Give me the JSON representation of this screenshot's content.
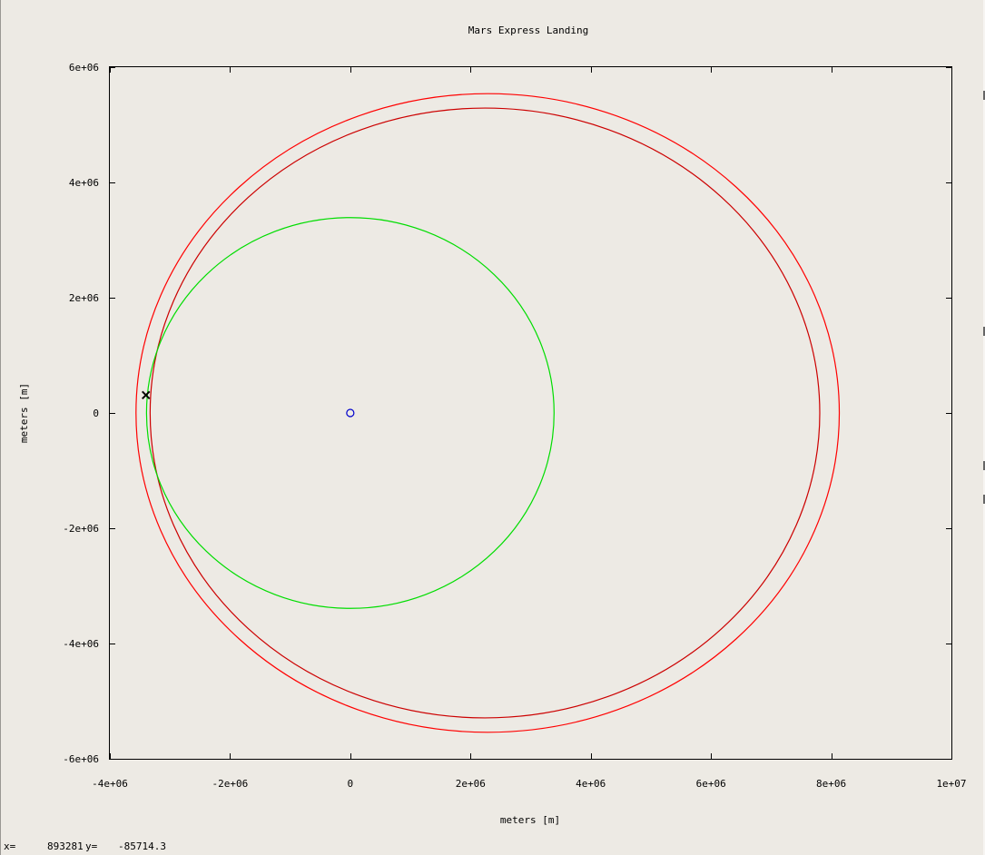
{
  "chart_data": {
    "type": "line",
    "title": "Mars Express Landing",
    "xlabel": "meters [m]",
    "ylabel": "meters [m]",
    "xlim": [
      -4000000,
      10000000
    ],
    "ylim": [
      -6000000,
      6000000
    ],
    "x_ticks": [
      {
        "value": -4000000,
        "label": "-4e+06"
      },
      {
        "value": -2000000,
        "label": "-2e+06"
      },
      {
        "value": 0,
        "label": "0"
      },
      {
        "value": 2000000,
        "label": "2e+06"
      },
      {
        "value": 4000000,
        "label": "4e+06"
      },
      {
        "value": 6000000,
        "label": "6e+06"
      },
      {
        "value": 8000000,
        "label": "8e+06"
      },
      {
        "value": 10000000,
        "label": "1e+07"
      }
    ],
    "y_ticks": [
      {
        "value": -6000000,
        "label": "-6e+06"
      },
      {
        "value": -4000000,
        "label": "-4e+06"
      },
      {
        "value": -2000000,
        "label": "-2e+06"
      },
      {
        "value": 0,
        "label": "0"
      },
      {
        "value": 2000000,
        "label": "2e+06"
      },
      {
        "value": 4000000,
        "label": "4e+06"
      },
      {
        "value": 6000000,
        "label": "6e+06"
      }
    ],
    "grid": false,
    "legend": "none",
    "series": [
      {
        "kind": "ellipse",
        "color": "#ff0000",
        "center": [
          2285000,
          0
        ],
        "radii": [
          5850000,
          5540000
        ]
      },
      {
        "kind": "ellipse",
        "color": "#cc0000",
        "center": [
          2240000,
          0
        ],
        "radii": [
          5570000,
          5290000
        ]
      },
      {
        "kind": "ellipse",
        "color": "#00dd00",
        "center": [
          0,
          0
        ],
        "radii": [
          3390000,
          3390000
        ]
      },
      {
        "kind": "marker",
        "shape": "circle",
        "color": "#0000cc",
        "point": [
          0,
          0
        ]
      },
      {
        "kind": "marker",
        "shape": "cross",
        "color": "#000000",
        "point": [
          -3400000,
          310000
        ]
      }
    ]
  },
  "status": {
    "x_label": "x=",
    "x_value": "893281",
    "y_label": "y=",
    "y_value": "-85714.3"
  }
}
